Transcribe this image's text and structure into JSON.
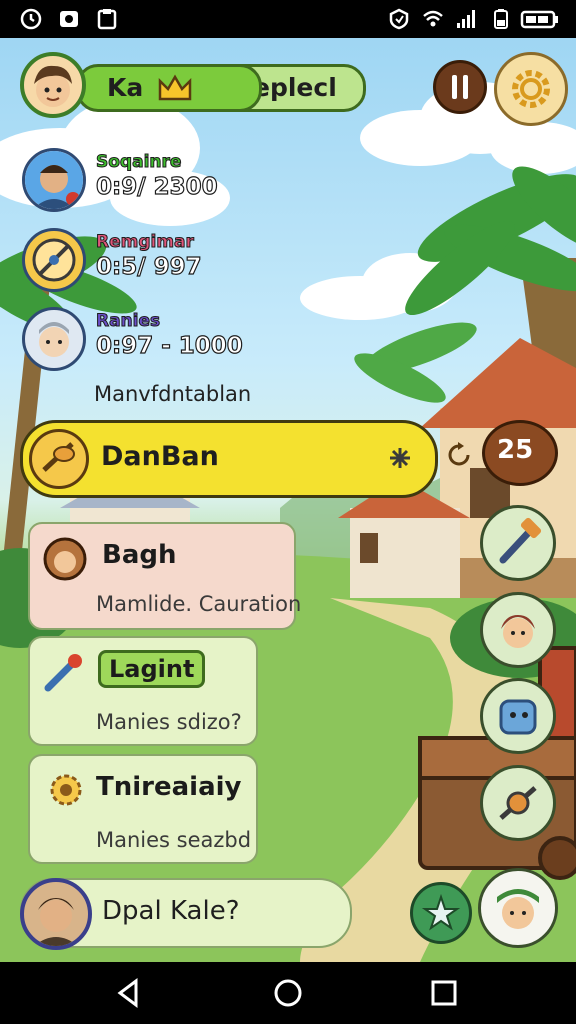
{
  "status_bar": {
    "left_icons": [
      "clock-icon",
      "camera-icon",
      "clipboard-icon"
    ],
    "right_icons": [
      "vpn-icon",
      "wifi-icon",
      "signal-icon",
      "battery-low-icon",
      "battery-icon"
    ]
  },
  "header": {
    "player_name": "Ka",
    "crown_icon": "crown-icon",
    "mode_label": "Seplecl",
    "pause_icon": "pause-icon",
    "settings_icon": "gear-icon"
  },
  "rankings": [
    {
      "name": "Soqainre",
      "score": "0:9/ 2300",
      "name_color": "#3fbf2f"
    },
    {
      "name": "Remgimar",
      "score": "0:5/ 997",
      "name_color": "#e0567a"
    },
    {
      "name": "Ranies",
      "score": "0:97 - 1000",
      "name_color": "#6a4ec9"
    }
  ],
  "section_label": "Manvfdntablan",
  "highlight": {
    "label": "DanBan",
    "count_icon": "x5-badge",
    "count_label": "25"
  },
  "cards": [
    {
      "title": "Bagh",
      "subtitle": "Mamlide. Cauration",
      "bg": "#f5d9cc"
    },
    {
      "title": "Lagint",
      "subtitle": "Manies sdizo?",
      "bg": "#e6f3c8"
    },
    {
      "title": "Tnireaiaiy",
      "subtitle": "Manies seazbd",
      "bg": "#e6f3c8"
    }
  ],
  "bottom_pill": {
    "label": "Dpal Kale?"
  },
  "side_buttons": [
    "hammer-icon",
    "girl-avatar",
    "sack-icon",
    "compass-icon"
  ],
  "colors": {
    "accent_green": "#7ccb3c",
    "accent_yellow": "#f4e12f",
    "dark_brown": "#5a3319"
  }
}
